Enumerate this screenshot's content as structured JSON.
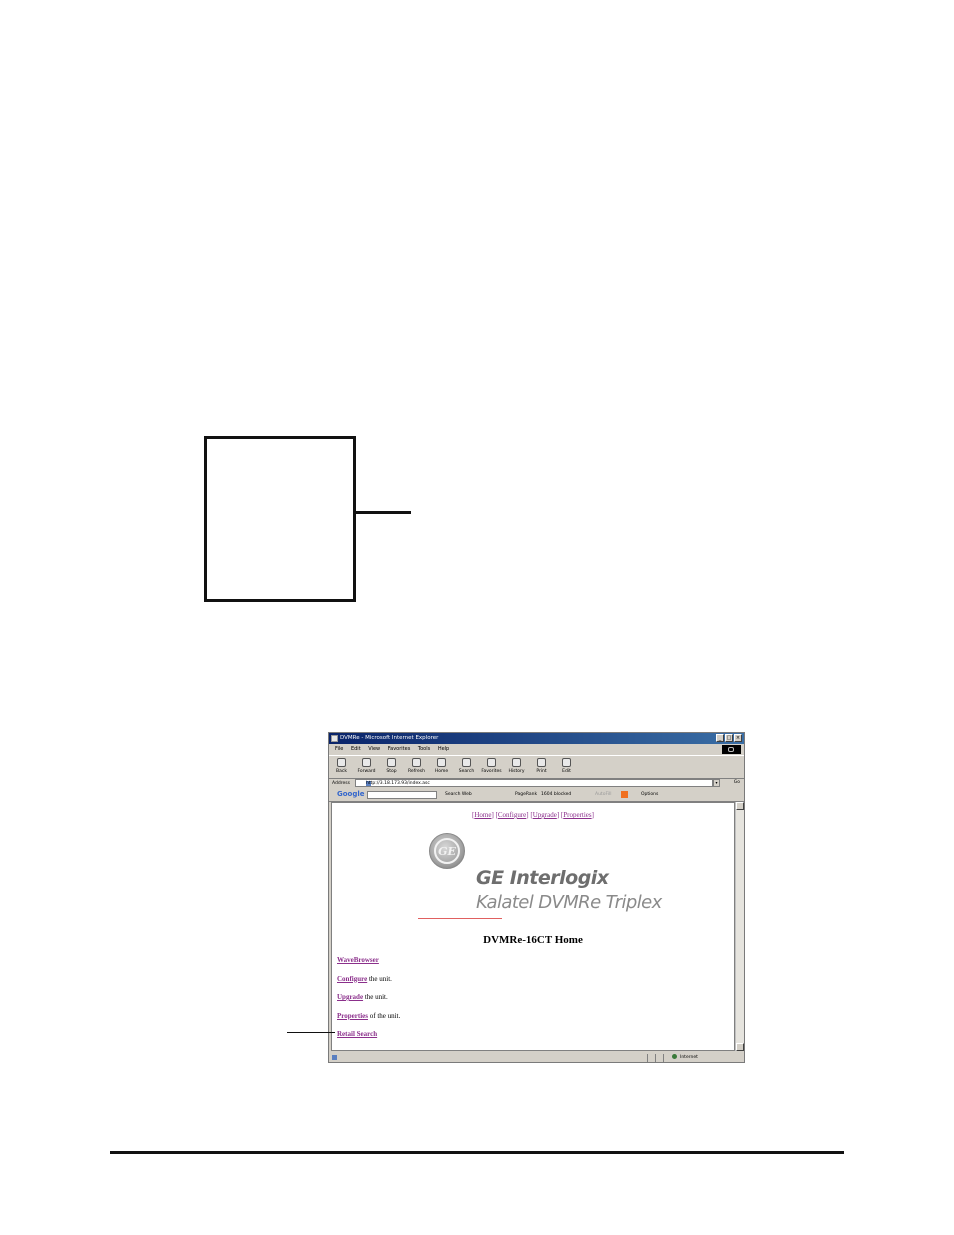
{
  "browser": {
    "title": "DVMRe - Microsoft Internet Explorer",
    "menu": [
      "File",
      "Edit",
      "View",
      "Favorites",
      "Tools",
      "Help"
    ],
    "toolbar": [
      "Back",
      "Forward",
      "Stop",
      "Refresh",
      "Home",
      "Search",
      "Favorites",
      "History",
      "Print",
      "Edit"
    ],
    "address_label": "Address",
    "address_value": "http://3.18.173.93/index.asc",
    "go_label": "Go",
    "google_bar": {
      "logo": "Google",
      "search_web": "Search Web",
      "pagerank": "PageRank",
      "blocked": "1604 blocked",
      "autofill": "AutoFill",
      "options": "Options"
    },
    "status_zone": "Internet"
  },
  "page": {
    "nav_links": [
      "Home",
      "Configure",
      "Upgrade",
      "Properties"
    ],
    "brand": "GE Interlogix",
    "product": "Kalatel DVMRe Triplex",
    "heading": "DVMRe-16CT Home",
    "links": [
      {
        "link": "WaveBrowser",
        "suffix": ""
      },
      {
        "link": "Configure",
        "suffix": " the unit."
      },
      {
        "link": "Upgrade",
        "suffix": " the unit."
      },
      {
        "link": "Properties",
        "suffix": " of the unit."
      },
      {
        "link": "Retail Search",
        "suffix": ""
      }
    ]
  },
  "colors": {
    "link": "#8b2f8b",
    "titlebar": "#0a246a",
    "chrome": "#d4d0c8",
    "accent_rule": "#e06060"
  },
  "icons": [
    "ge-monogram-icon",
    "back-icon",
    "forward-icon",
    "stop-icon",
    "refresh-icon",
    "home-icon",
    "search-icon",
    "favorites-icon",
    "history-icon",
    "print-icon",
    "edit-icon",
    "internet-zone-icon"
  ]
}
